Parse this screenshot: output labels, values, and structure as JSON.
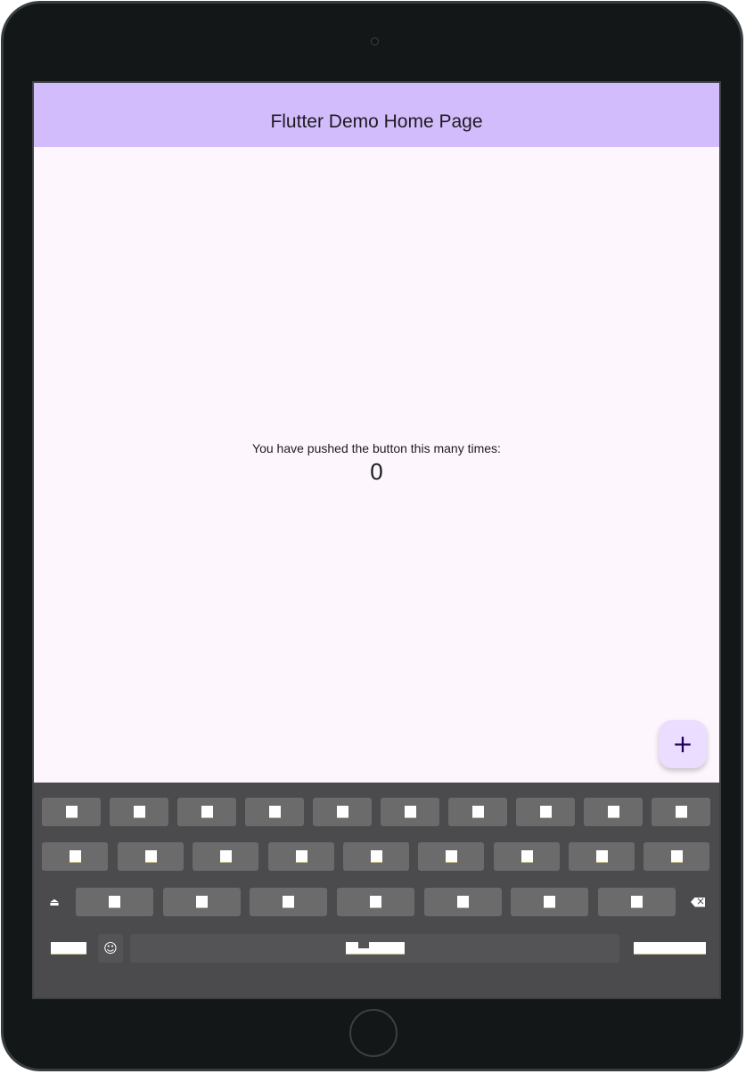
{
  "app": {
    "title": "Flutter Demo Home Page"
  },
  "counter": {
    "label": "You have pushed the button this many times:",
    "value": "0"
  },
  "fab": {
    "icon": "add-icon",
    "glyph": "+"
  },
  "colors": {
    "appbar": "#d3bcfc",
    "background": "#fdf7fd",
    "fab": "#eaddff",
    "keyboard": "#4b4b4d",
    "key": "#6b6b6b",
    "device_bezel": "#141718"
  },
  "keyboard": {
    "icons": {
      "shift": "shift-icon",
      "emoji": "emoji-icon",
      "backspace": "backspace-icon"
    },
    "shift_glyph": "⏏",
    "emoji_glyph": "☺"
  }
}
